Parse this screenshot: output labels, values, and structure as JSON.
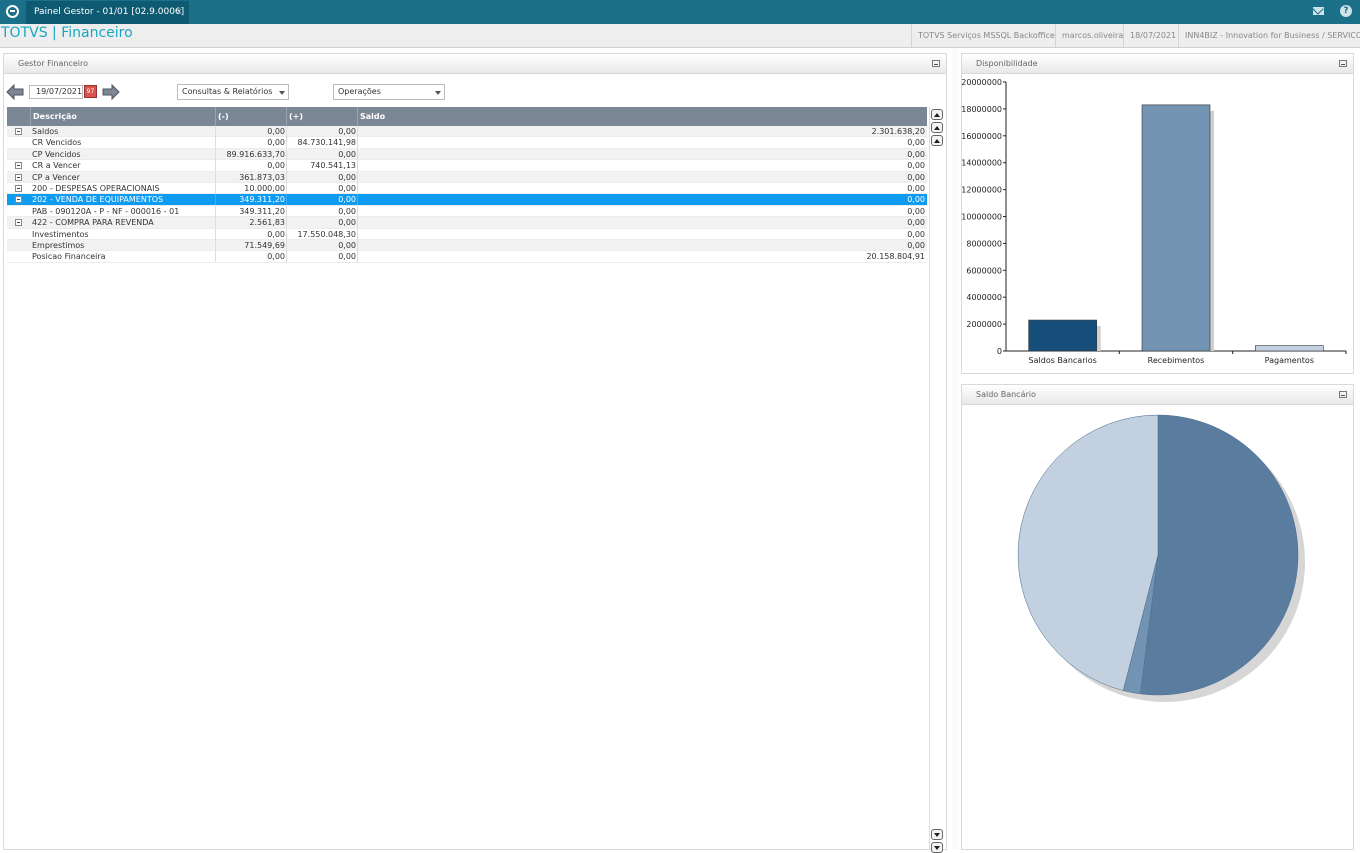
{
  "app": {
    "tab_title": "Painel Gestor - 01/01 [02.9.0006]",
    "tab_close": "×",
    "brand": "TOTVS | Financeiro",
    "help": "?",
    "header_info": [
      "TOTVS Serviços MSSQL Backoffice",
      "marcos.oliveira",
      "18/07/2021",
      "INN4BIZ - Innovation for Business / SERVICOS"
    ]
  },
  "gestor": {
    "title": "Gestor Financeiro",
    "date": "19/07/2021",
    "calendar_label": "97",
    "select1": "Consultas & Relatórios",
    "select2": "Operações",
    "columns": [
      "Descrição",
      "(-)",
      "(+)",
      "Saldo"
    ],
    "rows": [
      {
        "desc": "Saldos",
        "neg": "0,00",
        "pos": "0,00",
        "saldo": "2.301.638,20",
        "expander": true
      },
      {
        "desc": "CR Vencidos",
        "neg": "0,00",
        "pos": "84.730.141,98",
        "saldo": "0,00",
        "expander": false
      },
      {
        "desc": "CP Vencidos",
        "neg": "89.916.633,70",
        "pos": "0,00",
        "saldo": "0,00",
        "expander": false
      },
      {
        "desc": "CR a Vencer",
        "neg": "0,00",
        "pos": "740.541,13",
        "saldo": "0,00",
        "expander": true
      },
      {
        "desc": "CP a Vencer",
        "neg": "361.873,03",
        "pos": "0,00",
        "saldo": "0,00",
        "expander": true
      },
      {
        "desc": "200 - DESPESAS OPERACIONAIS",
        "neg": "10.000,00",
        "pos": "0,00",
        "saldo": "0,00",
        "expander": true
      },
      {
        "desc": "202 - VENDA DE EQUIPAMENTOS",
        "neg": "349.311,20",
        "pos": "0,00",
        "saldo": "0,00",
        "expander": true,
        "selected": true
      },
      {
        "desc": "PAB - 090120A - P - NF - 000016 - 01",
        "neg": "349.311,20",
        "pos": "0,00",
        "saldo": "0,00",
        "expander": false
      },
      {
        "desc": "422 - COMPRA PARA REVENDA",
        "neg": "2.561,83",
        "pos": "0,00",
        "saldo": "0,00",
        "expander": true
      },
      {
        "desc": "Investimentos",
        "neg": "0,00",
        "pos": "17.550.048,30",
        "saldo": "0,00",
        "expander": false
      },
      {
        "desc": "Emprestimos",
        "neg": "71.549,69",
        "pos": "0,00",
        "saldo": "0,00",
        "expander": false
      },
      {
        "desc": "Posicao Financeira",
        "neg": "0,00",
        "pos": "0,00",
        "saldo": "20.158.804,91",
        "expander": false
      }
    ]
  },
  "disponibilidade": {
    "title": "Disponibilidade"
  },
  "saldo_bancario": {
    "title": "Saldo Bancário"
  },
  "chart_data": [
    {
      "type": "bar",
      "categories": [
        "Saldos Bancarios",
        "Recebimentos",
        "Pagamentos"
      ],
      "values": [
        2301638,
        18300000,
        400000
      ],
      "colors": [
        "#174f7c",
        "#7393b3",
        "#c2d0e0"
      ],
      "ylim": [
        0,
        20000000
      ],
      "yticks": [
        0,
        2000000,
        4000000,
        6000000,
        8000000,
        10000000,
        12000000,
        14000000,
        16000000,
        18000000,
        20000000
      ],
      "grid": false
    },
    {
      "type": "pie",
      "values": [
        52,
        2,
        46
      ],
      "colors": [
        "#5a7d9f",
        "#7393b3",
        "#c2d0e0"
      ]
    }
  ]
}
